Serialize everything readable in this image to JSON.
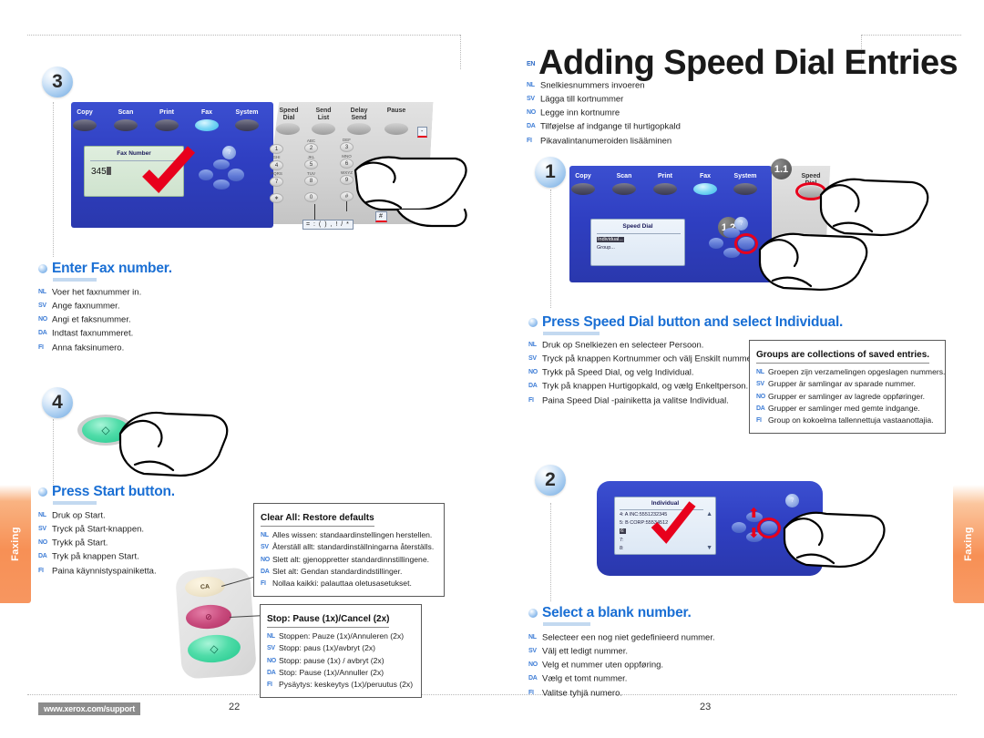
{
  "document": {
    "title_en": "Adding Speed Dial Entries",
    "en_tag": "EN",
    "title_translations": [
      {
        "lang": "NL",
        "text": "Snelkiesnummers invoeren"
      },
      {
        "lang": "SV",
        "text": "Lägga till kortnummer"
      },
      {
        "lang": "NO",
        "text": "Legge inn kortnumre"
      },
      {
        "lang": "DA",
        "text": "Tilføjelse af indgange til hurtigopkald"
      },
      {
        "lang": "FI",
        "text": "Pikavalintanumeroiden lisääminen"
      }
    ]
  },
  "side_tabs": {
    "left_label": "Faxing",
    "right_label": "Faxing"
  },
  "footer": {
    "url": "www.xerox.com/support",
    "left_page": "22",
    "right_page": "23"
  },
  "left_page": {
    "step3": {
      "number": "3",
      "heading": "Enter Fax number.",
      "translations": [
        {
          "lang": "NL",
          "text": "Voer het faxnummer in."
        },
        {
          "lang": "SV",
          "text": "Ange faxnummer."
        },
        {
          "lang": "NO",
          "text": "Angi et faksnummer."
        },
        {
          "lang": "DA",
          "text": "Indtast faxnummeret."
        },
        {
          "lang": "FI",
          "text": "Anna faksinumero."
        }
      ],
      "panel": {
        "mode_buttons": [
          "Copy",
          "Scan",
          "Print",
          "Fax",
          "System"
        ],
        "fax_buttons": [
          "Speed Dial",
          "Send List",
          "Delay Send",
          "Pause"
        ],
        "lcd_title": "Fax Number",
        "lcd_value": "345",
        "keypad": [
          {
            "key": "1",
            "sub": ""
          },
          {
            "key": "2",
            "sub": "ABC"
          },
          {
            "key": "3",
            "sub": "DEF"
          },
          {
            "key": "4",
            "sub": "GHI"
          },
          {
            "key": "5",
            "sub": "JKL"
          },
          {
            "key": "6",
            "sub": "MNO"
          },
          {
            "key": "7",
            "sub": "PQRS"
          },
          {
            "key": "8",
            "sub": "TUV"
          },
          {
            "key": "9",
            "sub": "WXYZ"
          },
          {
            "key": "∗",
            "sub": ""
          },
          {
            "key": "0",
            "sub": ""
          },
          {
            "key": "#",
            "sub": ""
          }
        ],
        "star_tip": "= : ( ) , ! / *",
        "hash_tip": "#",
        "pause_tip": "-"
      }
    },
    "step4": {
      "number": "4",
      "heading": "Press Start button.",
      "translations": [
        {
          "lang": "NL",
          "text": "Druk op Start."
        },
        {
          "lang": "SV",
          "text": "Tryck på Start-knappen."
        },
        {
          "lang": "NO",
          "text": "Trykk på Start."
        },
        {
          "lang": "DA",
          "text": "Tryk på knappen Start."
        },
        {
          "lang": "FI",
          "text": "Paina käynnistyspainiketta."
        }
      ],
      "buttons": {
        "clear_all": "CA",
        "stop": "⊘",
        "start": "◇"
      }
    },
    "callout_clear_all": {
      "title": "Clear All: Restore defaults",
      "rows": [
        {
          "lang": "NL",
          "text": "Alles wissen: standaardinstellingen herstellen."
        },
        {
          "lang": "SV",
          "text": "Återställ allt: standardinställningarna återställs."
        },
        {
          "lang": "NO",
          "text": "Slett alt: gjenoppretter standardinnstillingene."
        },
        {
          "lang": "DA",
          "text": "Slet alt: Gendan standardindstillinger."
        },
        {
          "lang": "FI",
          "text": "Nollaa kaikki: palauttaa oletusasetukset."
        }
      ]
    },
    "callout_stop": {
      "title": "Stop: Pause (1x)/Cancel (2x)",
      "rows": [
        {
          "lang": "NL",
          "text": "Stoppen: Pauze (1x)/Annuleren (2x)"
        },
        {
          "lang": "SV",
          "text": "Stopp: paus (1x)/avbryt (2x)"
        },
        {
          "lang": "NO",
          "text": "Stopp: pause (1x) / avbryt (2x)"
        },
        {
          "lang": "DA",
          "text": "Stop: Pause (1x)/Annuller (2x)"
        },
        {
          "lang": "FI",
          "text": "Pysäytys: keskeytys (1x)/peruutus (2x)"
        }
      ]
    }
  },
  "right_page": {
    "step1": {
      "number": "1",
      "sub_1": "1.1",
      "sub_2": "1.2",
      "heading": "Press Speed Dial button and select Individual.",
      "translations": [
        {
          "lang": "NL",
          "text": "Druk op Snelkiezen en selecteer Persoon."
        },
        {
          "lang": "SV",
          "text": "Tryck på knappen Kortnummer och välj Enskilt nummer."
        },
        {
          "lang": "NO",
          "text": "Trykk på Speed Dial, og velg Individual."
        },
        {
          "lang": "DA",
          "text": "Tryk på knappen Hurtigopkald, og vælg Enkeltperson."
        },
        {
          "lang": "FI",
          "text": "Paina Speed Dial -painiketta ja valitse Individual."
        }
      ],
      "panel": {
        "mode_buttons": [
          "Copy",
          "Scan",
          "Print",
          "Fax",
          "System"
        ],
        "speed_dial_label": "Speed Dial",
        "lcd_title": "Speed Dial",
        "lcd_lines": [
          "Individual...",
          "Group..."
        ]
      }
    },
    "step2": {
      "number": "2",
      "heading": "Select a blank number.",
      "translations": [
        {
          "lang": "NL",
          "text": "Selecteer een nog niet gedefinieerd nummer."
        },
        {
          "lang": "SV",
          "text": "Välj ett ledigt nummer."
        },
        {
          "lang": "NO",
          "text": "Velg et nummer uten oppføring."
        },
        {
          "lang": "DA",
          "text": "Vælg et tomt nummer."
        },
        {
          "lang": "FI",
          "text": "Valitse tyhjä numero."
        }
      ],
      "panel": {
        "lcd_title": "Individual",
        "lcd_lines": [
          "4: A INC:5551232345",
          "5: B CORP:55534512",
          "6:",
          "7:",
          "8:"
        ],
        "selected_index": 2
      }
    },
    "callout_groups": {
      "title": "Groups are collections of saved entries.",
      "rows": [
        {
          "lang": "NL",
          "text": "Groepen zijn verzamelingen opgeslagen nummers."
        },
        {
          "lang": "SV",
          "text": "Grupper är samlingar av sparade nummer."
        },
        {
          "lang": "NO",
          "text": "Grupper er samlinger av lagrede oppføringer."
        },
        {
          "lang": "DA",
          "text": "Grupper er samlinger med gemte indgange."
        },
        {
          "lang": "FI",
          "text": "Group on kokoelma tallennettuja vastaanottajia."
        }
      ]
    }
  },
  "colors": {
    "heading_blue": "#1a6fd4",
    "lang_blue": "#3E7DD6",
    "tab_orange": "#F79055",
    "accent_red": "#E8001C",
    "panel_blue": "#2f3fc2"
  }
}
